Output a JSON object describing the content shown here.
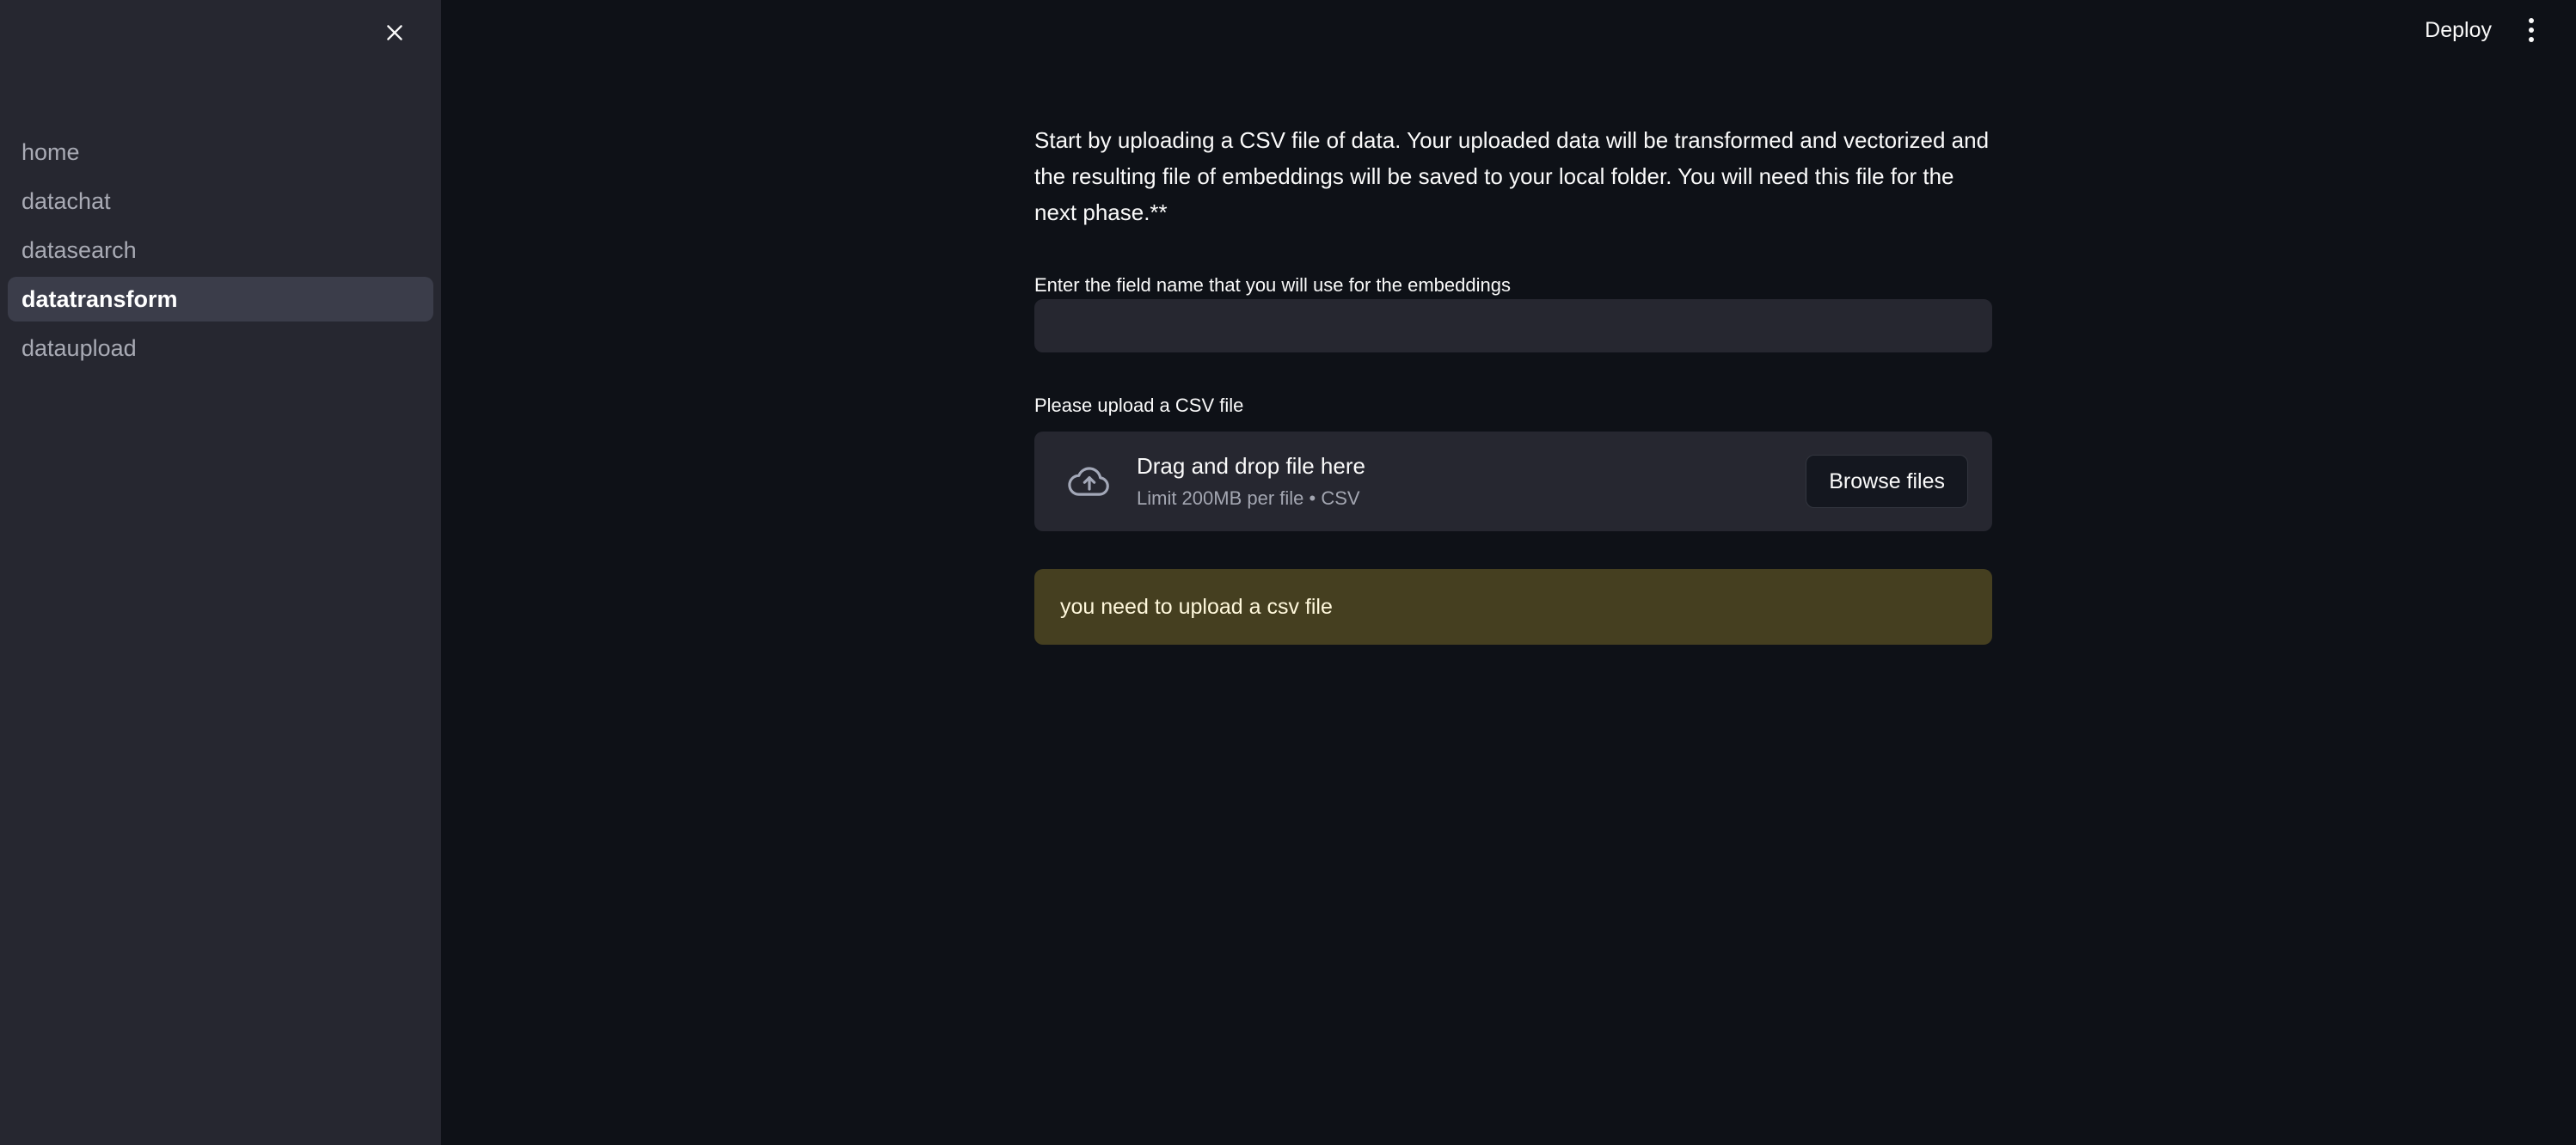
{
  "sidebar": {
    "close_icon": "close-icon",
    "items": [
      {
        "label": "home",
        "active": false
      },
      {
        "label": "datachat",
        "active": false
      },
      {
        "label": "datasearch",
        "active": false
      },
      {
        "label": "datatransform",
        "active": true
      },
      {
        "label": "dataupload",
        "active": false
      }
    ]
  },
  "header": {
    "deploy_label": "Deploy",
    "menu_icon": "kebab-menu-icon"
  },
  "main": {
    "intro_text": "Start by uploading a CSV file of data. Your uploaded data will be transformed and vectorized and the resulting file of embeddings will be saved to your local folder. You will need this file for the next phase.**",
    "field_name": {
      "label": "Enter the field name that you will use for the embeddings",
      "value": "",
      "placeholder": ""
    },
    "uploader": {
      "label": "Please upload a CSV file",
      "icon": "cloud-upload-icon",
      "drag_text": "Drag and drop file here",
      "limit_text": "Limit 200MB per file • CSV",
      "browse_label": "Browse files"
    },
    "warning": {
      "message": "you need to upload a csv file"
    }
  },
  "colors": {
    "app_background": "#0E1117",
    "sidebar_background": "#262730",
    "active_nav_background": "#3B3D4A",
    "widget_background": "#262730",
    "warning_background": "#453F20",
    "warning_text": "#FFF8DC",
    "text_primary": "#FAFAFA",
    "text_muted": "#A9ABB5"
  }
}
